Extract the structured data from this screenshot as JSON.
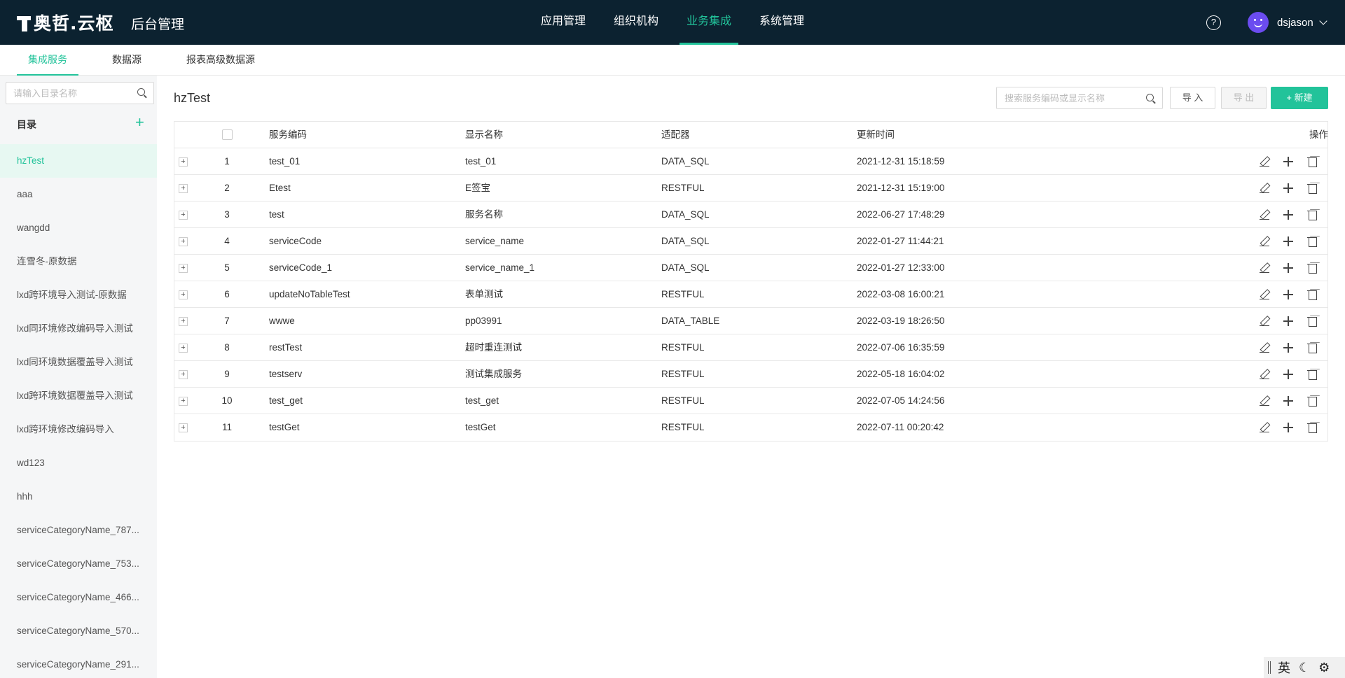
{
  "header": {
    "logo_text": "奥哲.云枢",
    "app_title": "后台管理",
    "nav": [
      {
        "label": "应用管理",
        "active": false
      },
      {
        "label": "组织机构",
        "active": false
      },
      {
        "label": "业务集成",
        "active": true
      },
      {
        "label": "系统管理",
        "active": false
      }
    ],
    "help_glyph": "?",
    "username": "dsjason"
  },
  "subtabs": [
    {
      "label": "集成服务",
      "active": true
    },
    {
      "label": "数据源",
      "active": false
    },
    {
      "label": "报表高级数据源",
      "active": false
    }
  ],
  "sidebar": {
    "search_placeholder": "请输入目录名称",
    "catalog_title": "目录",
    "add_glyph": "+",
    "items": [
      {
        "label": "hzTest",
        "active": true
      },
      {
        "label": "aaa"
      },
      {
        "label": "wangdd"
      },
      {
        "label": "连雪冬-原数据"
      },
      {
        "label": "lxd跨环境导入测试-原数据"
      },
      {
        "label": "lxd同环境修改编码导入测试"
      },
      {
        "label": "lxd同环境数据覆盖导入测试"
      },
      {
        "label": "lxd跨环境数据覆盖导入测试"
      },
      {
        "label": "lxd跨环境修改编码导入"
      },
      {
        "label": "wd123"
      },
      {
        "label": "hhh"
      },
      {
        "label": "serviceCategoryName_787..."
      },
      {
        "label": "serviceCategoryName_753..."
      },
      {
        "label": "serviceCategoryName_466..."
      },
      {
        "label": "serviceCategoryName_570..."
      },
      {
        "label": "serviceCategoryName_291..."
      }
    ]
  },
  "main": {
    "title": "hzTest",
    "search_placeholder": "搜索服务编码或显示名称",
    "import_label": "导 入",
    "export_label": "导 出",
    "new_label": "+ 新建",
    "table": {
      "columns": {
        "code": "服务编码",
        "name": "显示名称",
        "adapter": "适配器",
        "time": "更新时间",
        "ops": "操作"
      },
      "expand_glyph": "+",
      "rows": [
        {
          "idx": "1",
          "code": "test_01",
          "name": "test_01",
          "adapter": "DATA_SQL",
          "time": "2021-12-31 15:18:59"
        },
        {
          "idx": "2",
          "code": "Etest",
          "name": "E签宝",
          "adapter": "RESTFUL",
          "time": "2021-12-31 15:19:00"
        },
        {
          "idx": "3",
          "code": "test",
          "name": "服务名称",
          "adapter": "DATA_SQL",
          "time": "2022-06-27 17:48:29"
        },
        {
          "idx": "4",
          "code": "serviceCode",
          "name": "service_name",
          "adapter": "DATA_SQL",
          "time": "2022-01-27 11:44:21"
        },
        {
          "idx": "5",
          "code": "serviceCode_1",
          "name": "service_name_1",
          "adapter": "DATA_SQL",
          "time": "2022-01-27 12:33:00"
        },
        {
          "idx": "6",
          "code": "updateNoTableTest",
          "name": "表单测试",
          "adapter": "RESTFUL",
          "time": "2022-03-08 16:00:21"
        },
        {
          "idx": "7",
          "code": "wwwe",
          "name": "pp03991",
          "adapter": "DATA_TABLE",
          "time": "2022-03-19 18:26:50"
        },
        {
          "idx": "8",
          "code": "restTest",
          "name": "超时重连测试",
          "adapter": "RESTFUL",
          "time": "2022-07-06 16:35:59"
        },
        {
          "idx": "9",
          "code": "testserv",
          "name": "测试集成服务",
          "adapter": "RESTFUL",
          "time": "2022-05-18 16:04:02"
        },
        {
          "idx": "10",
          "code": "test_get",
          "name": "test_get",
          "adapter": "RESTFUL",
          "time": "2022-07-05 14:24:56"
        },
        {
          "idx": "11",
          "code": "testGet",
          "name": "testGet",
          "adapter": "RESTFUL",
          "time": "2022-07-11 00:20:42"
        }
      ]
    }
  },
  "ime": {
    "lang": "英",
    "moon": "☾",
    "gear": "⚙"
  },
  "colors": {
    "accent": "#22c39a",
    "topbar": "#0c2230",
    "avatar": "#6b4cf0"
  }
}
